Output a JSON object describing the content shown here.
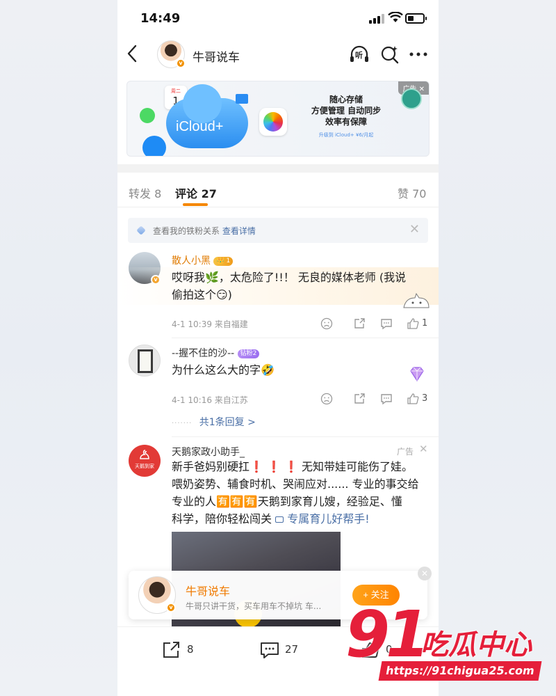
{
  "status_bar": {
    "time": "14:49"
  },
  "nav": {
    "title": "牛哥说车",
    "listen_label": "听"
  },
  "ad_banner": {
    "calendar_weekday": "周二",
    "calendar_day": "1",
    "product": "iCloud+",
    "headline_1": "随心存储",
    "headline_2": "方便管理 自动同步",
    "headline_3": "效率有保障",
    "sub": "升级到 iCloud+ ¥6/月起",
    "tag": "广告 ✕"
  },
  "tabs": {
    "repost": "转发 8",
    "comment": "评论 27",
    "like": "赞 70"
  },
  "fan_notice": {
    "text": "查看我的铁粉关系",
    "link": "查看详情"
  },
  "comments": [
    {
      "name": "散人小黑",
      "name_color": "#e07a00",
      "level": "1",
      "text_line1": "哎呀我🌿，太危险了!!！ 无良的媒体老师 (我说",
      "text_line2": "偷拍这个😏)",
      "meta": "4-1 10:39 来自福建",
      "likes": "1"
    },
    {
      "name": "--握不住的沙--",
      "name_color": "#333333",
      "badge": "钻粉2",
      "text": "为什么这么大的字🤣",
      "meta": "4-1 10:16 来自江苏",
      "likes": "3",
      "replies": "共1条回复 >"
    },
    {
      "name": "天鹅家政小助手_",
      "ad_tag": "广告",
      "avatar_text": "天鹅到家",
      "line1": "新手爸妈别硬扛❗ ❗ ❗ 无知带娃可能伤了娃。",
      "line2": "喂奶姿势、辅食时机、哭闹应对...... 专业的事交给",
      "line3": "专业的人🈶🈶🈶天鹅到家育儿嫂，经验足、懂",
      "line4": "科学，陪你轻松闯关",
      "line4_link": "专属育儿好帮手!"
    }
  ],
  "float_card": {
    "name": "牛哥说车",
    "desc": "牛哥只讲干货，买车用车不掉坑 车...",
    "follow": "+ 关注"
  },
  "bottom_bar": {
    "repost_count": "8",
    "comment_count": "27",
    "like_count": "0"
  },
  "watermark": {
    "number": "91",
    "brand": "吃瓜中心",
    "url": "https://91chigua25.com"
  },
  "colors": {
    "accent": "#f58700",
    "link": "#4a6fa6",
    "watermark": "#e51f3a"
  }
}
